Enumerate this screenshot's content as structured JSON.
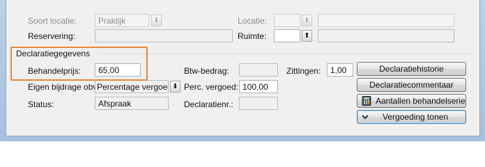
{
  "row_location": {
    "soort_locatie_label": "Soort locatie:",
    "soort_locatie_value": "Praktijk",
    "locatie_label": "Locatie:",
    "locatie_code": "",
    "locatie_desc": ""
  },
  "row_reservation": {
    "reservering_label": "Reservering:",
    "reservering_value": "",
    "ruimte_label": "Ruimte:",
    "ruimte_code": "",
    "ruimte_desc": ""
  },
  "section": {
    "title": "Declaratiegegevens"
  },
  "row_price": {
    "behandelprijs_label": "Behandelprijs:",
    "behandelprijs_value": "65,00",
    "btw_label": "Btw-bedrag:",
    "btw_value": "",
    "zittingen_label": "Zittingen:",
    "zittingen_value": "1,00"
  },
  "row_contribution": {
    "eigen_bijdrage_label": "Eigen bijdrage obv:",
    "eigen_bijdrage_value": "Percentage vergoed",
    "perc_label": "Perc. vergoed:",
    "perc_value": "100,00"
  },
  "row_status": {
    "status_label": "Status:",
    "status_value": "Afspraak",
    "declaratienr_label": "Declaratienr.:",
    "declaratienr_value": ""
  },
  "buttons": {
    "historie": "Declaratiehistorie",
    "commentaar": "Declaratiecommentaar",
    "aantallen": "Aantallen behandelserie",
    "vergoeding": "Vergoeding tonen"
  },
  "icons": {
    "dropdown": "down-arrow-icon",
    "calculator": "calculator-icon",
    "chevron": "chevron-down-icon"
  },
  "colors": {
    "highlight": "#e8863a",
    "panel": "#f0f0f0",
    "frame": "#b3c9e2"
  }
}
